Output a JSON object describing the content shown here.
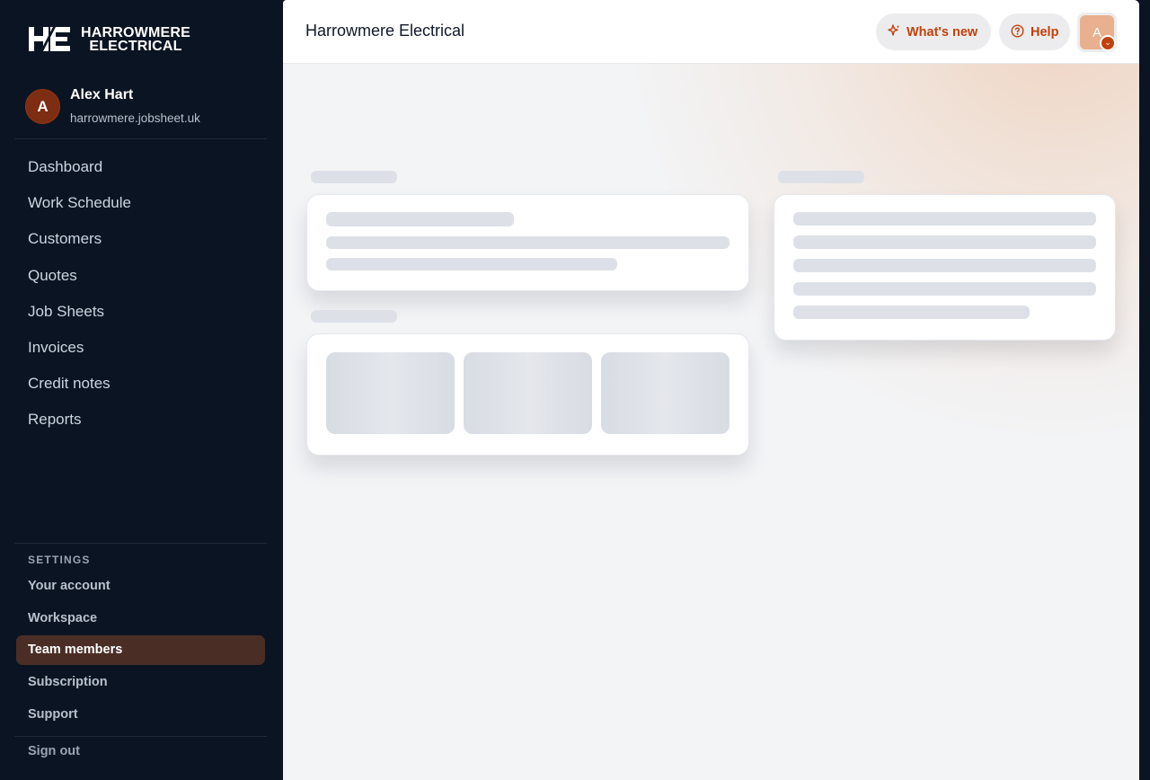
{
  "brand": {
    "line1": "HARROWMERE",
    "line2": "ELECTRICAL"
  },
  "profile": {
    "initial": "A",
    "name": "Alex Hart",
    "domain": "harrowmere.jobsheet.uk"
  },
  "nav": [
    {
      "label": "Dashboard"
    },
    {
      "label": "Work Schedule"
    },
    {
      "label": "Customers"
    },
    {
      "label": "Quotes"
    },
    {
      "label": "Job Sheets"
    },
    {
      "label": "Invoices"
    },
    {
      "label": "Credit notes"
    },
    {
      "label": "Reports"
    }
  ],
  "settings": {
    "title": "SETTINGS",
    "items": [
      {
        "label": "Your account"
      },
      {
        "label": "Workspace"
      },
      {
        "label": "Team members",
        "active": true
      },
      {
        "label": "Subscription"
      },
      {
        "label": "Support"
      }
    ],
    "signout": "Sign out"
  },
  "header": {
    "title": "Harrowmere Electrical",
    "whats_new": "What's new",
    "help": "Help",
    "user_initial": "A"
  },
  "colors": {
    "sidebar_bg": "#0b1422",
    "accent": "#c2410c",
    "active_item": "#4a2e26"
  }
}
